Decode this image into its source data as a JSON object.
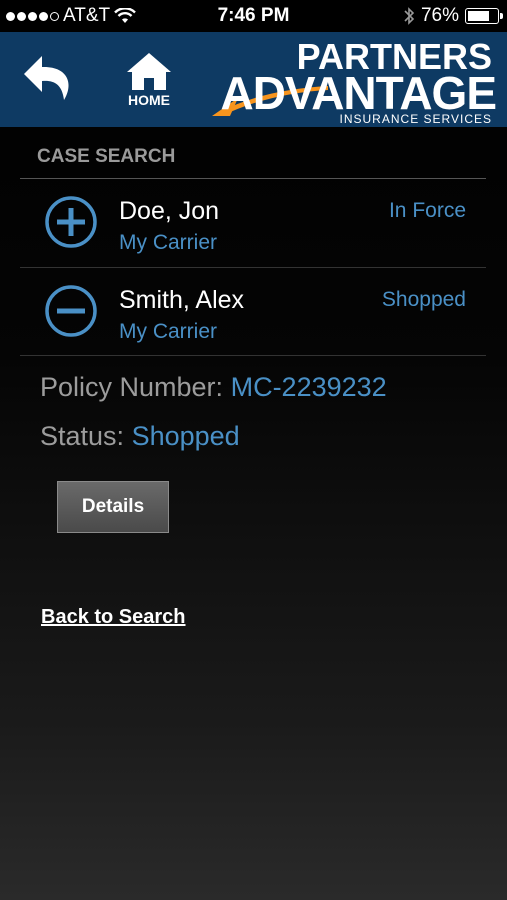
{
  "status_bar": {
    "carrier": "AT&T",
    "time": "7:46 PM",
    "battery": "76%",
    "battery_level": 0.76,
    "signal_dots_filled": 4,
    "signal_dots_total": 5
  },
  "header": {
    "home_label": "HOME",
    "logo": {
      "line1": "PARTNERS",
      "line2": "ADVANTAGE",
      "line3": "INSURANCE SERVICES"
    },
    "bg_color": "#0e3a63"
  },
  "section": {
    "title": "CASE SEARCH"
  },
  "cases": [
    {
      "name": "Doe, Jon",
      "carrier": "My Carrier",
      "status": "In Force",
      "icon": "plus-circle-icon",
      "expanded": false
    },
    {
      "name": "Smith, Alex",
      "carrier": "My Carrier",
      "status": "Shopped",
      "icon": "minus-circle-icon",
      "expanded": true
    }
  ],
  "detail": {
    "policy_label": "Policy Number:",
    "policy_value": "MC-2239232",
    "status_label": "Status:",
    "status_value": "Shopped"
  },
  "details_button": "Details",
  "back_to_search": "Back to Search",
  "colors": {
    "accent_blue": "#4a90c6",
    "logo_orange": "#f7941d"
  }
}
